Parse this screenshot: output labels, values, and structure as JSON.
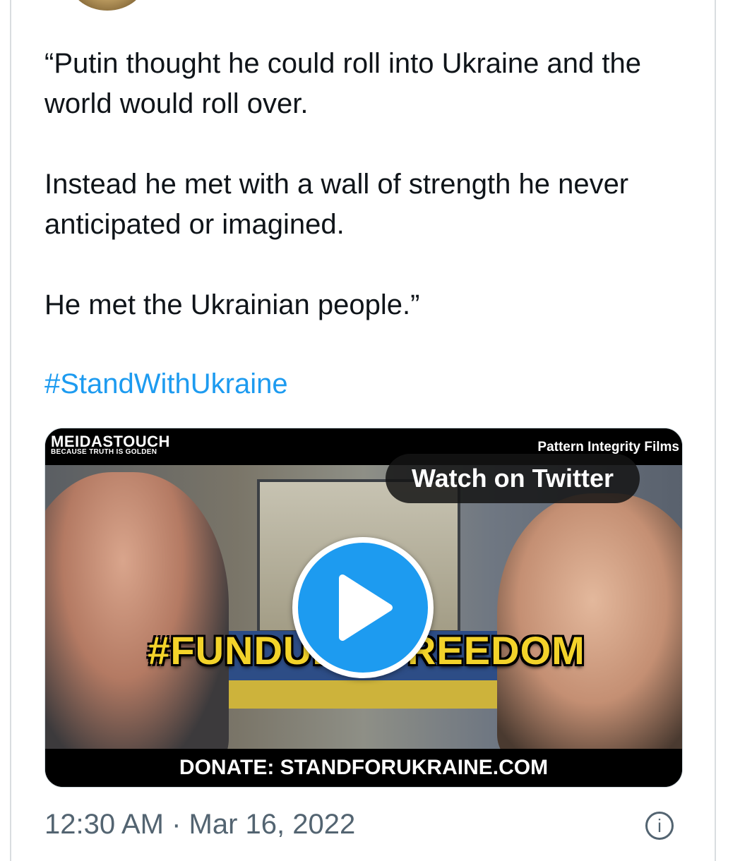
{
  "tweet": {
    "paragraphs": [
      "“Putin thought he could roll into Ukraine and the world would roll over.",
      "Instead he met with a wall of strength he never anticipated or imagined.",
      "He met the Ukrainian people.”"
    ],
    "hashtag": "#StandWithUkraine",
    "timestamp": "12:30 AM · Mar 16, 2022"
  },
  "media": {
    "brand": "MEIDASTOUCH",
    "brand_tagline": "BECAUSE TRUTH IS GOLDEN",
    "credit": "Pattern Integrity Films",
    "watch_label": "Watch on Twitter",
    "headline": "#FUNDUK     NFREEDOM",
    "donate_line": "DONATE: STANDFORUKRAINE.COM"
  },
  "icons": {
    "play": "play-icon",
    "info": "info-icon"
  },
  "colors": {
    "link": "#1d9bf0",
    "play_button": "#1d9bf0",
    "headline": "#f3d32a",
    "secondary_text": "#536471"
  }
}
